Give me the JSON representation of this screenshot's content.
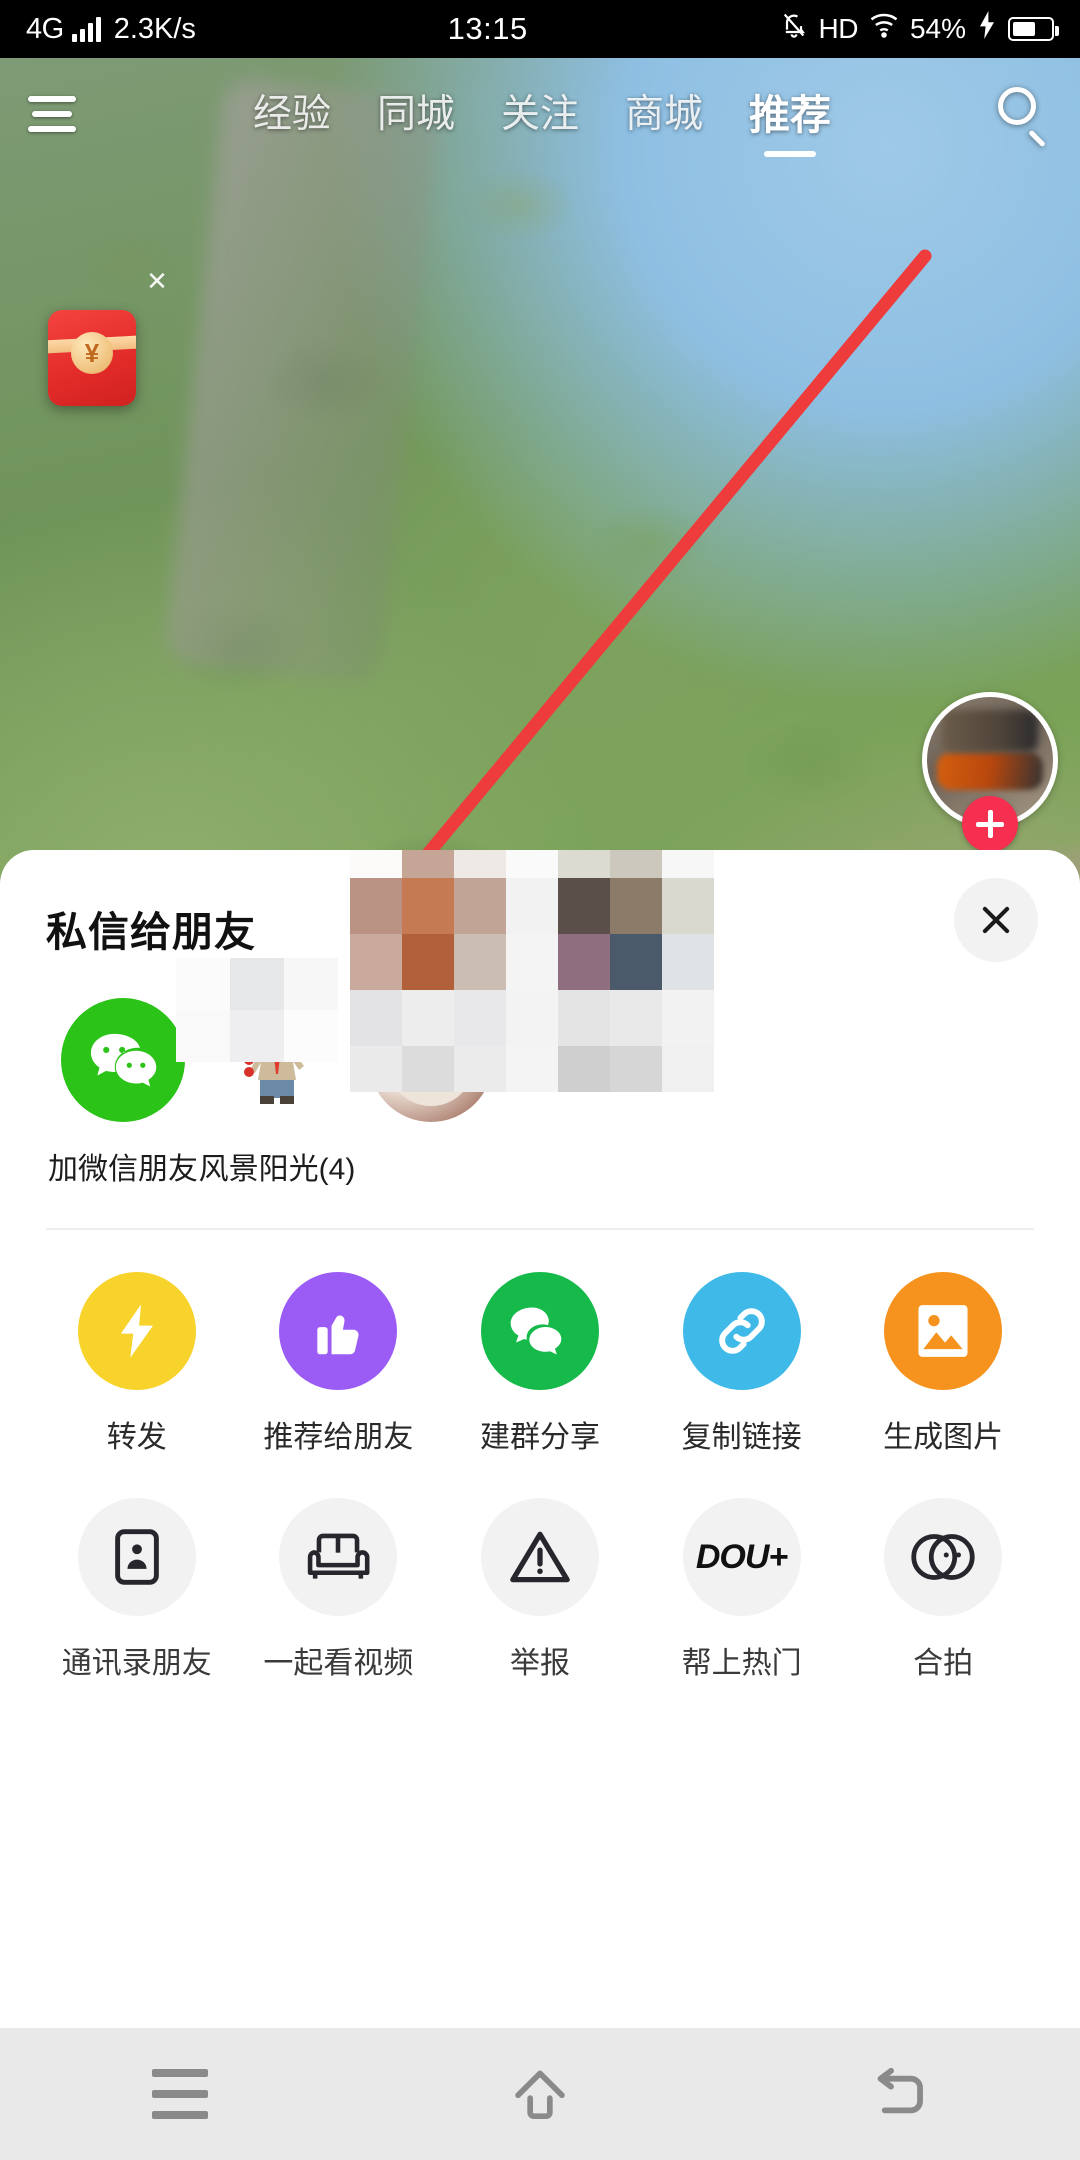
{
  "status_bar": {
    "network_type": "4G",
    "speed": "2.3K/s",
    "time": "13:15",
    "hd_label": "HD",
    "battery_percent": "54%"
  },
  "top_nav": {
    "menu_icon": "hamburger-icon",
    "search_icon": "search-icon",
    "tabs": [
      {
        "label": "经验",
        "active": false
      },
      {
        "label": "同城",
        "active": false
      },
      {
        "label": "关注",
        "active": false
      },
      {
        "label": "商城",
        "active": false
      },
      {
        "label": "推荐",
        "active": true
      }
    ]
  },
  "video_overlay": {
    "red_packet": {
      "icon": "red-packet-icon",
      "currency_symbol": "¥",
      "close_icon": "close-icon"
    },
    "author": {
      "avatar": "author-avatar",
      "follow_icon": "plus-icon"
    },
    "like": {
      "icon": "heart-icon"
    },
    "annotation": {
      "icon": "red-arrow-annotation",
      "color": "#EE3B3B"
    }
  },
  "share_sheet": {
    "title": "私信给朋友",
    "close_icon": "close-icon",
    "friends": [
      {
        "label": "加微信朋友",
        "icon": "wechat-icon",
        "color": "#2BC317",
        "censored": false
      },
      {
        "label": "风景阳光(4)",
        "icon": "bear-avatar",
        "censored": false
      },
      {
        "label": "",
        "icon": "cat-avatar",
        "censored": true
      },
      {
        "label": "",
        "icon": "friend-avatar",
        "censored": true
      },
      {
        "label": "",
        "icon": "friend-avatar",
        "censored": true
      }
    ],
    "actions_row1": [
      {
        "label": "转发",
        "icon": "lightning-icon",
        "color": "#F8D32B"
      },
      {
        "label": "推荐给朋友",
        "icon": "thumbs-up-icon",
        "color": "#9B5CF6"
      },
      {
        "label": "建群分享",
        "icon": "chat-bubbles-icon",
        "color": "#16BA4A"
      },
      {
        "label": "复制链接",
        "icon": "link-icon",
        "color": "#3FB9E8"
      },
      {
        "label": "生成图片",
        "icon": "image-icon",
        "color": "#F6921E"
      }
    ],
    "actions_row2": [
      {
        "label": "通讯录朋友",
        "icon": "contact-card-icon",
        "color": "#F2F2F3"
      },
      {
        "label": "一起看视频",
        "icon": "sofa-icon",
        "color": "#F2F2F3"
      },
      {
        "label": "举报",
        "icon": "warning-triangle-icon",
        "color": "#F2F2F3"
      },
      {
        "label": "帮上热门",
        "icon": "dou-plus-icon",
        "color": "#F2F2F3",
        "logo_text": "DOU+"
      },
      {
        "label": "合拍",
        "icon": "duet-circles-icon",
        "color": "#F2F2F3"
      }
    ]
  },
  "nav_bar": {
    "recent_icon": "recents-icon",
    "home_icon": "home-icon",
    "back_icon": "back-icon"
  }
}
